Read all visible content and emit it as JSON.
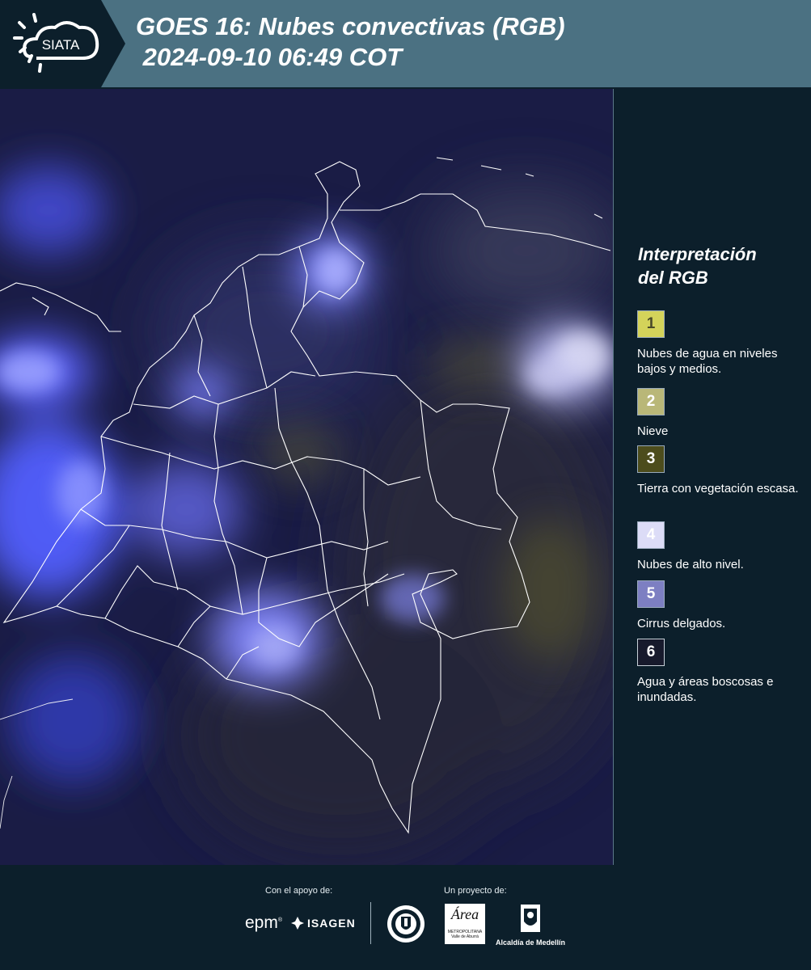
{
  "header": {
    "logo_text": "SIATA",
    "title_line1": "GOES 16: Nubes convectivas (RGB)",
    "title_line2": " 2024-09-10 06:49 COT"
  },
  "legend": {
    "title_line1": "Interpretación",
    "title_line2": "del RGB",
    "items": [
      {
        "number": "1",
        "label": "Nubes de agua en niveles bajos y medios.",
        "color": "#d4d35a",
        "text_color": "#4a4a2a"
      },
      {
        "number": "2",
        "label": "Nieve",
        "color": "#b9b778",
        "text_color": "#ffffff"
      },
      {
        "number": "3",
        "label": "Tierra con vegetación escasa.",
        "color": "#4c4c1c",
        "text_color": "#ffffff"
      },
      {
        "number": "4",
        "label": "Nubes de alto nivel.",
        "color": "#dcdcf7",
        "text_color": "#ffffff"
      },
      {
        "number": "5",
        "label": "Cirrus delgados.",
        "color": "#7d7fc2",
        "text_color": "#ffffff"
      },
      {
        "number": "6",
        "label": "Agua y áreas boscosas e inundadas.",
        "color": "#171a2c",
        "text_color": "#ffffff"
      }
    ]
  },
  "footer": {
    "support_label": "Con el apoyo de:",
    "project_label": "Un proyecto de:",
    "epm": "epm",
    "isagen": "ISAGEN",
    "area_name": "Área",
    "area_sub": "METROPOLITANA Valle de Aburrá",
    "alcaldia": "Alcaldía de Medellín"
  },
  "map": {
    "ocean_color": "#15183f",
    "cloud_color": "#4a55e8",
    "border_color": "#ffffff"
  }
}
